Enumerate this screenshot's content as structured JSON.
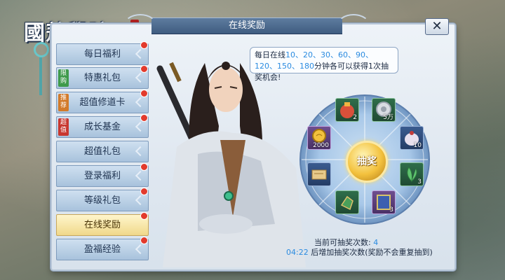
{
  "logo": {
    "text": "國敖學院"
  },
  "window": {
    "title": "在线奖励",
    "close_label": "✕"
  },
  "sidebar": {
    "items": [
      {
        "label": "每日福利",
        "tag": "",
        "active": false
      },
      {
        "label": "特惠礼包",
        "tag": "限购",
        "active": false
      },
      {
        "label": "超值修道卡",
        "tag": "推荐",
        "active": false
      },
      {
        "label": "成长基金",
        "tag": "超值",
        "active": false
      },
      {
        "label": "超值礼包",
        "tag": "",
        "active": false
      },
      {
        "label": "登录福利",
        "tag": "",
        "active": false
      },
      {
        "label": "等级礼包",
        "tag": "",
        "active": false
      },
      {
        "label": "在线奖励",
        "tag": "",
        "active": true
      },
      {
        "label": "盈福经验",
        "tag": "",
        "active": false
      }
    ]
  },
  "bubble": {
    "prefix": "每日在线",
    "minutes": "10、20、30、60、90、120、150、180",
    "suffix": "分钟各可以获得1次抽奖机会!"
  },
  "wheel": {
    "spin_label": "抽奖",
    "rewards": [
      {
        "icon": "red-pouch-icon",
        "amount": "2"
      },
      {
        "icon": "silver-coin-icon",
        "amount": "5万"
      },
      {
        "icon": "medicine-bag-icon",
        "amount": "10"
      },
      {
        "icon": "green-herb-icon",
        "amount": "3"
      },
      {
        "icon": "blue-book-icon",
        "amount": "3"
      },
      {
        "icon": "green-gem-icon",
        "amount": ""
      },
      {
        "icon": "scroll-map-icon",
        "amount": ""
      },
      {
        "icon": "gold-ingot-icon",
        "amount": "2000"
      }
    ]
  },
  "info": {
    "draws_label": "当前可抽奖次数:",
    "draws_value": "4",
    "timer": "04:22",
    "timer_suffix": "后增加抽奖次数(奖励不会重复抽到)"
  },
  "colors": {
    "accent_blue": "#2b8be0",
    "badge_red": "#e23a2c",
    "active_gold": "#f0d88a"
  }
}
